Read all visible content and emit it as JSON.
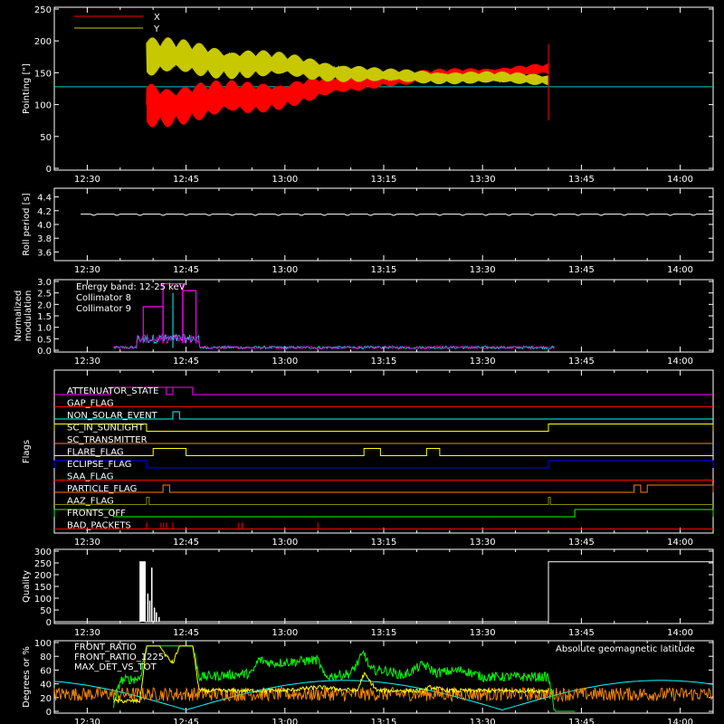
{
  "chart_data": [
    {
      "id": "pointing",
      "type": "line",
      "ylabel": "Pointing [\"]",
      "ylim": [
        0,
        250
      ],
      "yticks": [
        0,
        50,
        100,
        150,
        200,
        250
      ],
      "xlim_min": [
        750,
        850
      ],
      "legend": [
        {
          "name": "X",
          "color": "#ff0000"
        },
        {
          "name": "Y",
          "color": "#c8c800"
        }
      ],
      "series": [
        {
          "name": "X",
          "color": "#ff0000",
          "t_start_min": 764,
          "t_end_min": 825,
          "center": [
            [
              764,
              100
            ],
            [
              780,
              110
            ],
            [
              800,
              140
            ],
            [
              825,
              155
            ]
          ],
          "amplitude": [
            [
              764,
              40
            ],
            [
              780,
              28
            ],
            [
              800,
              12
            ],
            [
              825,
              10
            ]
          ]
        },
        {
          "name": "Y",
          "color": "#c8c800",
          "t_start_min": 764,
          "t_end_min": 825,
          "center": [
            [
              764,
              175
            ],
            [
              780,
              165
            ],
            [
              800,
              145
            ],
            [
              825,
              140
            ]
          ],
          "amplitude": [
            [
              764,
              35
            ],
            [
              780,
              25
            ],
            [
              800,
              12
            ],
            [
              825,
              10
            ]
          ]
        }
      ],
      "baseline": {
        "value": 128,
        "color": "#00c8c8"
      },
      "spike": {
        "t_min": 825,
        "from": 75,
        "to": 195,
        "color": "#ff0000"
      }
    },
    {
      "id": "roll",
      "type": "line",
      "ylabel": "Roll period [s]",
      "ylim": [
        3.5,
        4.5
      ],
      "yticks": [
        3.6,
        3.8,
        4.0,
        4.2,
        4.4
      ],
      "tick_labels": [
        "3.6",
        "3.8",
        "4.0",
        "4.2",
        "4.4"
      ],
      "series": [
        {
          "name": "",
          "color": "#ffffff",
          "value": 4.15
        }
      ]
    },
    {
      "id": "modulation",
      "type": "line",
      "ylabel": [
        "Normalized",
        "modulation"
      ],
      "ylim": [
        0,
        3.0
      ],
      "yticks": [
        0.0,
        0.5,
        1.0,
        1.5,
        2.0,
        2.5,
        3.0
      ],
      "tick_labels": [
        "0.0",
        "0.5",
        "1.0",
        "1.5",
        "2.0",
        "2.5",
        "3.0"
      ],
      "legend": [
        {
          "name": "Energy band: 12-25 keV",
          "color": "#ffffff"
        },
        {
          "name": "Collimator 8",
          "color": "#00ffff"
        },
        {
          "name": "Collimator 9",
          "color": "#ff00ff"
        }
      ],
      "series": [
        {
          "name": "Collimator 8",
          "color": "#00ffff",
          "spike_t": 768,
          "spike_value": 2.5
        },
        {
          "name": "Collimator 9",
          "color": "#ff00ff",
          "start_t": 759,
          "end_t": 826,
          "bursts": [
            [
              763.5,
              766.5,
              1.9
            ],
            [
              766.5,
              769.5,
              2.9
            ],
            [
              769.5,
              771.5,
              2.6
            ]
          ]
        }
      ]
    },
    {
      "id": "flags",
      "type": "line",
      "ylabel": "Flags",
      "flags": [
        {
          "name": "ATTENUATOR_STATE",
          "color": "#ff00ff",
          "high_intervals": [
            [
              758.5,
              768
            ],
            [
              767,
              771
            ]
          ]
        },
        {
          "name": "GAP_FLAG",
          "color": "#ff0000",
          "high_intervals": []
        },
        {
          "name": "NON_SOLAR_EVENT",
          "color": "#00ffff",
          "high_intervals": [
            [
              768,
              769
            ]
          ]
        },
        {
          "name": "SC_IN_SUNLIGHT",
          "color": "#ffff00",
          "high_intervals": [
            [
              750,
              764
            ],
            [
              825,
              850
            ]
          ],
          "inverted": true
        },
        {
          "name": "SC_TRANSMITTER",
          "color": "#ff7f00",
          "high_intervals": []
        },
        {
          "name": "FLARE_FLAG",
          "color": "#ffff00",
          "high_intervals": [
            [
              765,
              770
            ],
            [
              797,
              799.5
            ],
            [
              806.5,
              808.5
            ]
          ]
        },
        {
          "name": "ECLIPSE_FLAG",
          "color": "#0000ff",
          "high_intervals": [
            [
              750,
              764
            ],
            [
              825,
              850
            ]
          ]
        },
        {
          "name": "SAA_FLAG",
          "color": "#ff0000",
          "high_intervals": []
        },
        {
          "name": "PARTICLE_FLAG",
          "color": "#ff7f00",
          "high_intervals": [
            [
              766.5,
              767.5
            ],
            [
              838,
              839
            ],
            [
              840,
              850
            ]
          ]
        },
        {
          "name": "AAZ_FLAG",
          "color": "#888800",
          "high_intervals": [
            [
              764,
              764.4
            ],
            [
              825,
              825.3
            ]
          ]
        },
        {
          "name": "FRONTS_OFF",
          "color": "#00ff00",
          "high_intervals": [
            [
              750,
              759
            ],
            [
              829,
              850
            ]
          ]
        },
        {
          "name": "BAD_PACKETS",
          "color": "#ff0000",
          "high_intervals": []
        }
      ],
      "bad_packet_spikes": [
        764,
        766.2,
        766.6,
        767,
        768,
        778,
        778.5,
        790
      ]
    },
    {
      "id": "quality",
      "type": "bar",
      "ylabel": "Quality",
      "ylim": [
        0,
        300
      ],
      "yticks": [
        0,
        50,
        100,
        150,
        200,
        250,
        300
      ],
      "high_intervals": [
        [
          763,
          763.8
        ],
        [
          825,
          850
        ]
      ],
      "high_value": 255,
      "scatter": [
        [
          764.2,
          120
        ],
        [
          764.5,
          90
        ],
        [
          764.8,
          230
        ],
        [
          765.2,
          60
        ],
        [
          765.5,
          40
        ],
        [
          765.9,
          20
        ]
      ]
    },
    {
      "id": "ratios",
      "type": "line",
      "ylabel": "Degrees or %",
      "ylim": [
        0,
        100
      ],
      "yticks": [
        0,
        20,
        40,
        60,
        80,
        100
      ],
      "legend": [
        {
          "name": "FRONT_RATIO",
          "color": "#00ff00"
        },
        {
          "name": "FRONT_RATIO_1225",
          "color": "#ffff00"
        },
        {
          "name": "MAX_DET_VS_TOT",
          "color": "#ff8c00"
        }
      ],
      "annotation": {
        "text": "Absolute geomagnetic latitude",
        "color": "#00ffff"
      },
      "series": [
        {
          "name": "FRONT_RATIO",
          "color": "#00ff00",
          "profile": [
            [
              759,
              5
            ],
            [
              760,
              45
            ],
            [
              763,
              48
            ],
            [
              764,
              95
            ],
            [
              771,
              95
            ],
            [
              772,
              50
            ],
            [
              780,
              55
            ],
            [
              781,
              75
            ],
            [
              783,
              70
            ],
            [
              790,
              75
            ],
            [
              791,
              50
            ],
            [
              795,
              55
            ],
            [
              797,
              85
            ],
            [
              798,
              60
            ],
            [
              800,
              60
            ],
            [
              803,
              52
            ],
            [
              806,
              68
            ],
            [
              808,
              56
            ],
            [
              812,
              60
            ],
            [
              815,
              50
            ],
            [
              820,
              50
            ],
            [
              825,
              50
            ],
            [
              826,
              0
            ],
            [
              829,
              0
            ]
          ]
        },
        {
          "name": "FRONT_RATIO_1225",
          "color": "#ffff00",
          "profile": [
            [
              759,
              15
            ],
            [
              763,
              15
            ],
            [
              764,
              95
            ],
            [
              766,
              95
            ],
            [
              767,
              80
            ],
            [
              768,
              70
            ],
            [
              769,
              95
            ],
            [
              771,
              95
            ],
            [
              772,
              30
            ],
            [
              785,
              30
            ],
            [
              790,
              35
            ],
            [
              796,
              30
            ],
            [
              797,
              55
            ],
            [
              799,
              30
            ],
            [
              806,
              30
            ],
            [
              807,
              35
            ],
            [
              810,
              30
            ],
            [
              825,
              30
            ]
          ]
        },
        {
          "name": "MAX_DET_VS_TOT",
          "color": "#ff8c00",
          "mean": 25,
          "noise": 10
        }
      ],
      "latitude": {
        "color": "#00ffff",
        "period_min": 48,
        "phase_min": 770,
        "min": 2,
        "max": 45
      }
    }
  ],
  "xaxis": {
    "ticks": [
      755,
      765,
      775,
      785,
      795,
      805,
      815,
      825,
      835,
      845
    ],
    "tick_labels": [
      "12:30",
      "12:45",
      "13:00",
      "13:15",
      "13:30",
      "13:45",
      "14:00"
    ]
  }
}
